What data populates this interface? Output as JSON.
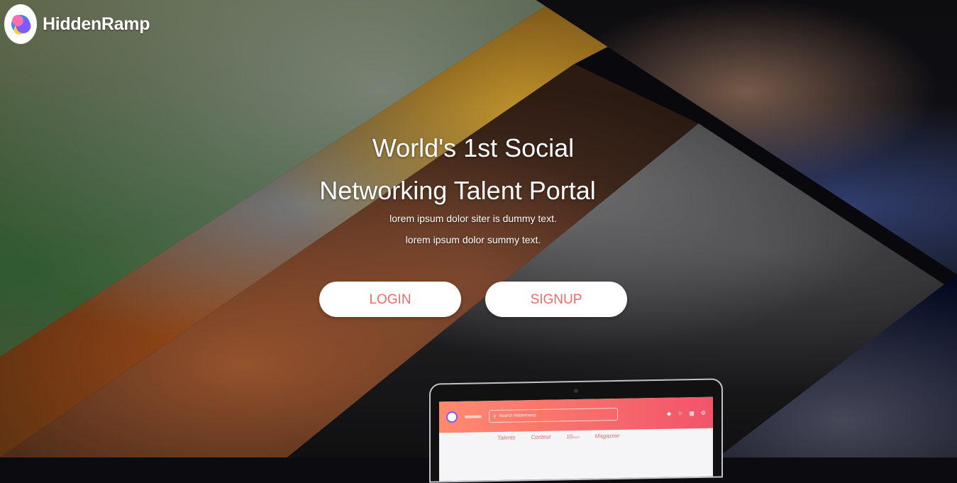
{
  "brand": {
    "name": "HiddenRamp"
  },
  "hero": {
    "title_line1": "World's 1st Social",
    "title_line2": "Networking Talent Portal",
    "subtitle_line1": "lorem ipsum dolor siter is dummy text.",
    "subtitle_line2": "lorem ipsum dolor summy text."
  },
  "actions": {
    "login_label": "LOGIN",
    "signup_label": "SIGNUP"
  },
  "colors": {
    "accent": "#f06a6a",
    "app_bar_start": "#ff8a6e",
    "app_bar_end": "#f2546a"
  },
  "laptop_app": {
    "search_placeholder": "Search hiddenramp",
    "nav": [
      "Talents",
      "Contest",
      "10ₙₙₙ",
      "Magazine"
    ],
    "icons": [
      "bell-icon",
      "star-icon",
      "chat-icon",
      "settings-icon"
    ]
  }
}
